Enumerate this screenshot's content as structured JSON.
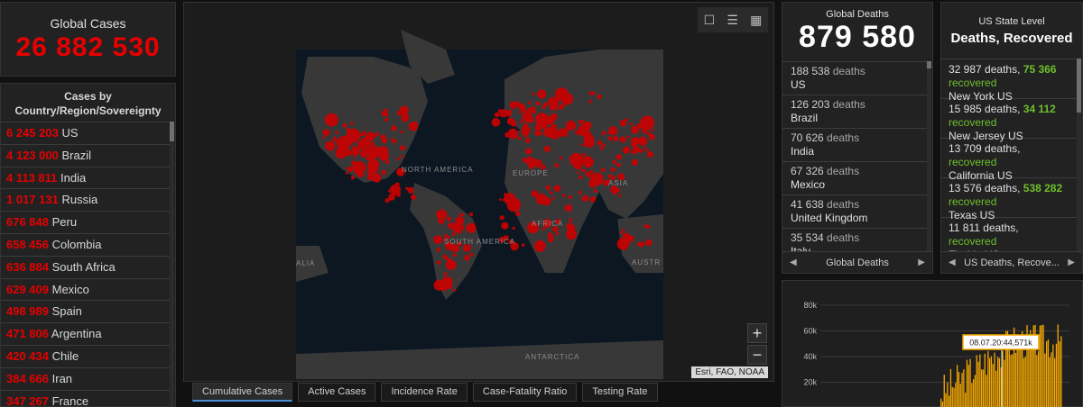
{
  "global_cases": {
    "title": "Global Cases",
    "value": "26 882 530"
  },
  "country_panel": {
    "title_line1": "Cases by",
    "title_line2": "Country/Region/Sovereignty",
    "rows": [
      {
        "cases": "6 245 203",
        "country": "US"
      },
      {
        "cases": "4 123 000",
        "country": "Brazil"
      },
      {
        "cases": "4 113 811",
        "country": "India"
      },
      {
        "cases": "1 017 131",
        "country": "Russia"
      },
      {
        "cases": "676 848",
        "country": "Peru"
      },
      {
        "cases": "658 456",
        "country": "Colombia"
      },
      {
        "cases": "636 884",
        "country": "South Africa"
      },
      {
        "cases": "629 409",
        "country": "Mexico"
      },
      {
        "cases": "498 989",
        "country": "Spain"
      },
      {
        "cases": "471 806",
        "country": "Argentina"
      },
      {
        "cases": "420 434",
        "country": "Chile"
      },
      {
        "cases": "384 666",
        "country": "Iran"
      },
      {
        "cases": "347 267",
        "country": "France"
      }
    ]
  },
  "map": {
    "labels": {
      "north_america": "NORTH AMERICA",
      "europe": "EUROPE",
      "asia": "ASIA",
      "africa": "AFRICA",
      "south_america": "SOUTH AMERICA",
      "antarctica": "ANTARCTICA",
      "australia_left": "ALIA",
      "australia_right": "AUSTR"
    },
    "toolbar": {
      "bookmark_icon": "bookmark-icon",
      "list_icon": "list-icon",
      "qr_icon": "qr-icon"
    },
    "zoom_in": "+",
    "zoom_out": "−",
    "attribution": "Esri, FAO, NOAA",
    "colors": {
      "ocean": "#0c1722",
      "land": "#383838",
      "dots": "#cc0000"
    }
  },
  "tabs": [
    {
      "label": "Cumulative Cases",
      "active": true
    },
    {
      "label": "Active Cases",
      "active": false
    },
    {
      "label": "Incidence Rate",
      "active": false
    },
    {
      "label": "Case-Fatality Ratio",
      "active": false
    },
    {
      "label": "Testing Rate",
      "active": false
    }
  ],
  "global_deaths": {
    "title": "Global Deaths",
    "value": "879 580",
    "deaths_word": "deaths",
    "rows": [
      {
        "deaths": "188 538",
        "place": "US"
      },
      {
        "deaths": "126 203",
        "place": "Brazil"
      },
      {
        "deaths": "70 626",
        "place": "India"
      },
      {
        "deaths": "67 326",
        "place": "Mexico"
      },
      {
        "deaths": "41 638",
        "place": "United Kingdom"
      },
      {
        "deaths": "35 534",
        "place": "Italy"
      }
    ],
    "pager_label": "Global Deaths"
  },
  "us_state": {
    "title_line1": "US State Level",
    "title_line2": "Deaths, Recovered",
    "deaths_word": "deaths,",
    "recovered_word": "recovered",
    "rows": [
      {
        "deaths": "32 987",
        "recovered": "75 366",
        "place": "New York US"
      },
      {
        "deaths": "15 985",
        "recovered": "34 112",
        "place": "New Jersey US"
      },
      {
        "deaths": "13 709",
        "recovered": "",
        "place": "California US"
      },
      {
        "deaths": "13 576",
        "recovered": "538 282",
        "place": "Texas US"
      },
      {
        "deaths": "11 811",
        "recovered": "",
        "place": "Florida US"
      }
    ],
    "pager_label": "US Deaths, Recove..."
  },
  "chart_data": {
    "type": "bar",
    "yticks": [
      "80k",
      "60k",
      "40k",
      "20k"
    ],
    "ylim": [
      0,
      80000
    ],
    "tooltip": "08.07.20:44,571k",
    "color": "#f5a800"
  }
}
